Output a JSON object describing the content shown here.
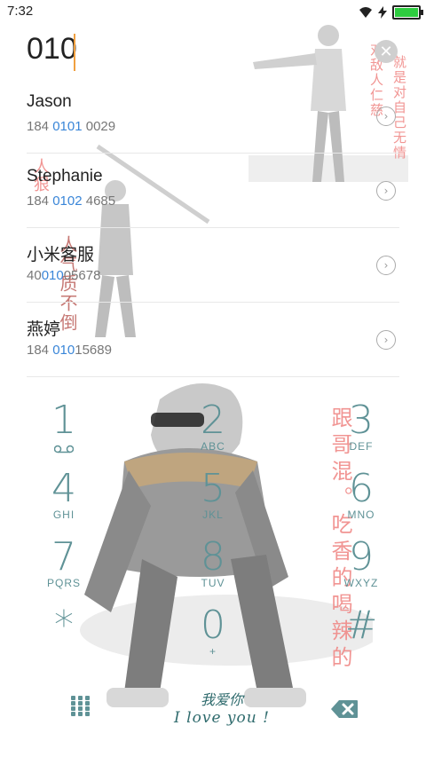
{
  "status_bar": {
    "time": "7:32",
    "wifi_icon": "wifi-icon",
    "charging_icon": "bolt-icon",
    "battery_icon": "battery-icon",
    "battery_level": 1.0,
    "battery_color": "#2ecc40"
  },
  "dialer": {
    "input_value": "010",
    "caret_color": "#f0a040",
    "clear_icon": "clear-icon"
  },
  "contacts": [
    {
      "name": "Jason",
      "number_pre": "184 ",
      "number_hl": "0101",
      "number_post": " 0029"
    },
    {
      "name": "Stephanie",
      "number_pre": "184 ",
      "number_hl": "0102",
      "number_post": " 4685"
    },
    {
      "name": "小米客服",
      "number_pre": "40",
      "number_hl": "010",
      "number_post": "05678"
    },
    {
      "name": "燕婷",
      "number_pre": "184 ",
      "number_hl": "010",
      "number_post": "15689"
    }
  ],
  "highlight_color": "#3a86d8",
  "keypad": [
    {
      "digit": "1",
      "letters": ""
    },
    {
      "digit": "2",
      "letters": "ABC"
    },
    {
      "digit": "3",
      "letters": "DEF"
    },
    {
      "digit": "4",
      "letters": "GHI"
    },
    {
      "digit": "5",
      "letters": "JKL"
    },
    {
      "digit": "6",
      "letters": "MNO"
    },
    {
      "digit": "7",
      "letters": "PQRS"
    },
    {
      "digit": "8",
      "letters": "TUV"
    },
    {
      "digit": "9",
      "letters": "WXYZ"
    },
    {
      "digit": "*",
      "letters": ""
    },
    {
      "digit": "0",
      "letters": "+"
    },
    {
      "digit": "#",
      "letters": ""
    }
  ],
  "keypad_color": "#5f9296",
  "bottom_bar": {
    "dialpad_icon": "dialpad-grid-icon",
    "backspace_icon": "backspace-icon",
    "love_cn": "我爱你",
    "love_en": "I love you !"
  },
  "wallpaper": {
    "text_top_right_a": "对敌人仁慈",
    "text_top_right_b": "就是对自己无情",
    "text_left": "人狠",
    "text_left_b": "人气质不倒",
    "text_right": "跟哥混。吃香的喝辣的",
    "text_color": "#f08a88"
  }
}
